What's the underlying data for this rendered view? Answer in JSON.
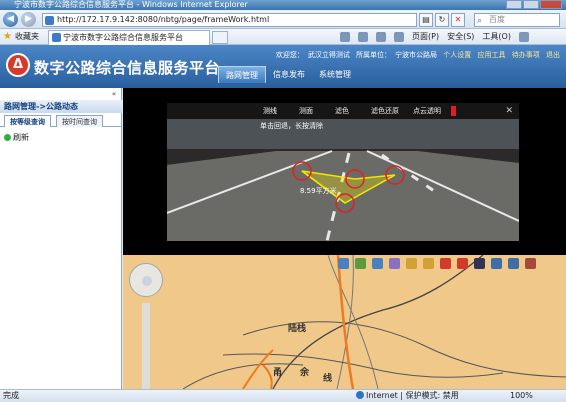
{
  "window": {
    "title": "宁波市数字公路综合信息服务平台 - Windows Internet Explorer"
  },
  "browser": {
    "url": "http://172.17.9.142:8080/nbtg/page/frameWork.html",
    "search_placeholder": "百度",
    "favorites_label": "收藏夹",
    "tab_title": "宁波市数字公路综合信息服务平台",
    "commands": [
      "页面(P)",
      "安全(S)",
      "工具(O)"
    ]
  },
  "app": {
    "title": "数字公路综合信息服务平台",
    "user": {
      "welcome": "欢迎您：",
      "name": "武汉立得测试",
      "unit_label": "所属单位：",
      "unit": "宁波市公路局",
      "links": [
        "个人设置",
        "应用工具",
        "待办事项",
        "退出"
      ]
    },
    "nav": [
      "路网管理",
      "信息发布",
      "系统管理"
    ]
  },
  "sidebar": {
    "breadcrumb": "路网管理->公路动态",
    "tabs": [
      "按等级查询",
      "按时间查询"
    ],
    "refresh_label": "刷新"
  },
  "video": {
    "menu": [
      "测线",
      "测面",
      "滤色",
      "滤色还原",
      "点云透明"
    ],
    "hint": "单击回退，长按清除",
    "measurement": "8.59平方米"
  },
  "map": {
    "labels": [
      "陆栈",
      "甬",
      "余",
      "线"
    ]
  },
  "statusbar": {
    "done": "完成",
    "zone": "Internet | 保护模式: 禁用",
    "zoom": "100%"
  },
  "colors": {
    "header": "#2a5f9e",
    "map_bg": "#f0c98a",
    "road_orange": "#f07a20",
    "measure_yellow": "#f2e600",
    "measure_red": "#e02020"
  }
}
